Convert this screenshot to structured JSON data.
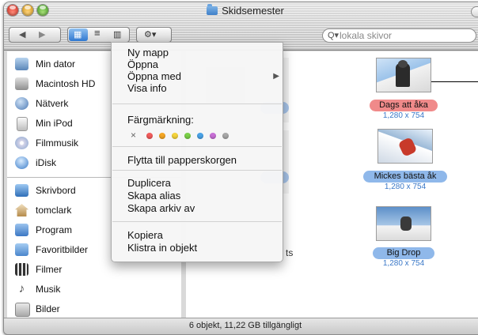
{
  "window": {
    "title": "Skidsemester"
  },
  "toolbar": {
    "back_glyph": "◀",
    "forward_glyph": "▶",
    "icon_view_glyph": "▦",
    "list_view_glyph": "≡",
    "column_view_glyph": "▥",
    "action_glyph": "⚙▾",
    "search_glyph": "Q▾",
    "search_placeholder": "lokala skivor"
  },
  "sidebar": {
    "devices": [
      {
        "label": "Min dator",
        "icon": "computer-icon"
      },
      {
        "label": "Macintosh HD",
        "icon": "hard-disk-icon"
      },
      {
        "label": "Nätverk",
        "icon": "network-icon"
      },
      {
        "label": "Min iPod",
        "icon": "ipod-icon"
      },
      {
        "label": "Filmmusik",
        "icon": "cd-icon"
      },
      {
        "label": "iDisk",
        "icon": "idisk-icon"
      }
    ],
    "places": [
      {
        "label": "Skrivbord",
        "icon": "desktop-icon"
      },
      {
        "label": "tomclark",
        "icon": "home-icon"
      },
      {
        "label": "Program",
        "icon": "applications-icon"
      },
      {
        "label": "Favoritbilder",
        "icon": "folder-icon"
      },
      {
        "label": "Filmer",
        "icon": "movies-icon"
      },
      {
        "label": "Musik",
        "icon": "music-icon"
      },
      {
        "label": "Bilder",
        "icon": "pictures-icon"
      }
    ]
  },
  "files": [
    {
      "name": "Dags att åka",
      "dims": "1,280 x 754",
      "label_color": "#f08a8a"
    },
    {
      "name": "Mickes bästa åk",
      "dims": "1,280 x 754",
      "label_color": "#8fb8ea"
    },
    {
      "name": "Big Drop",
      "dims": "1,280 x 754",
      "label_color": "#8fb8ea"
    }
  ],
  "partial_text": {
    "behind_menu": "ts"
  },
  "context_menu": {
    "new_folder": "Ny mapp",
    "open": "Öppna",
    "open_with": "Öppna med",
    "open_with_arrow": "▶",
    "show_info": "Visa info",
    "color_label": "Färgmärkning:",
    "clear_label": "×",
    "label_colors": [
      "#f25c5c",
      "#f5a623",
      "#f5d33b",
      "#7bd148",
      "#4aa3e8",
      "#c86fd6",
      "#a8a8a8"
    ],
    "move_to_trash": "Flytta till papperskorgen",
    "duplicate": "Duplicera",
    "make_alias": "Skapa alias",
    "create_archive": "Skapa arkiv av",
    "copy": "Kopiera",
    "paste": "Klistra in objekt"
  },
  "status": {
    "text": "6 objekt, 11,22 GB tillgängligt"
  }
}
